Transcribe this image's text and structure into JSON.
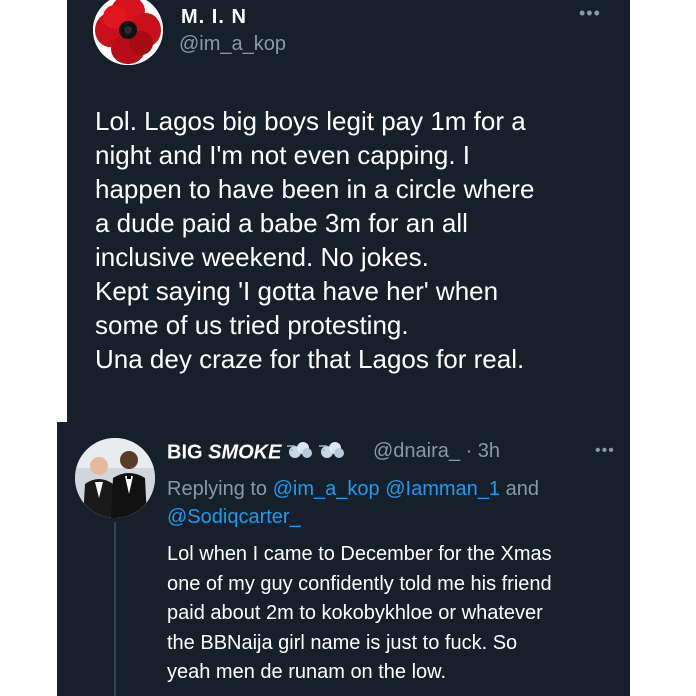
{
  "tweet": {
    "author_name": "M. I. N",
    "author_handle": "@im_a_kop",
    "avatar_icon": "red-poppy-avatar",
    "more_label": "•••",
    "lines": [
      "Lol. Lagos big boys legit pay 1m for a",
      "night and I'm not even capping. I",
      "happen to have been in a circle where",
      "a dude paid a babe 3m for an all",
      "inclusive weekend. No jokes.",
      "Kept saying 'I gotta have her' when",
      "some of us tried protesting.",
      "Una dey craze for that Lagos for real."
    ]
  },
  "reply": {
    "author_name_plain": "BIG ",
    "author_name_italic": "SMOKE",
    "name_emojis": [
      "dash-icon",
      "dash-icon"
    ],
    "handle_time": "@dnaira_ · 3h",
    "more_label": "•••",
    "replying_prefix": "Replying to ",
    "mention_1": "@im_a_kop",
    "mention_2": "@Iamman_1",
    "replying_and": " and",
    "mention_3": "@Sodiqcarter_",
    "lines": [
      "Lol when I came to December for the Xmas",
      "one of my guy confidently told me his friend",
      "paid about 2m to kokobykhloe or whatever",
      "the BBNaija girl name is just to fuck. So",
      "yeah men de runam on the low."
    ]
  },
  "colors": {
    "background": "#15202b",
    "text": "#ffffff",
    "secondary": "#8b98a5",
    "link": "#1d9bf0"
  }
}
